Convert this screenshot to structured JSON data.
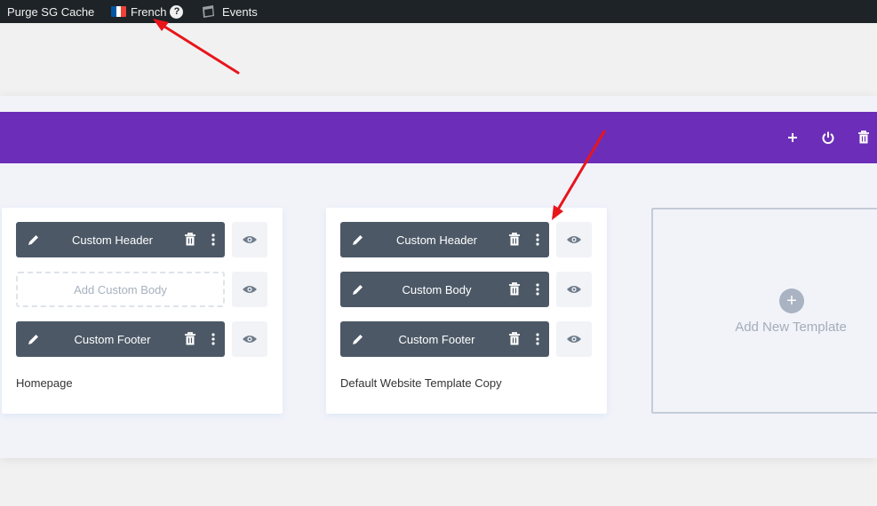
{
  "adminbar": {
    "purge_label": "Purge SG Cache",
    "language_label": "French",
    "help_glyph": "?",
    "events_label": "Events",
    "flag_colors": [
      "#0055a4",
      "#ffffff",
      "#ef4135"
    ]
  },
  "toolbar": {
    "add_glyph": "+",
    "icons": [
      "plus-icon",
      "power-icon",
      "trash-icon"
    ]
  },
  "colors": {
    "accent": "#6c2eb9",
    "slot": "#4c5866",
    "annotation": "#e8151b"
  },
  "templates": [
    {
      "title": "Homepage",
      "header": "Custom Header",
      "body": "Add Custom Body",
      "footer": "Custom Footer"
    },
    {
      "title": "Default Website Template Copy",
      "header": "Custom Header",
      "body": "Custom Body",
      "footer": "Custom Footer"
    }
  ],
  "add_template": {
    "plus_glyph": "+",
    "label": "Add New Template"
  }
}
